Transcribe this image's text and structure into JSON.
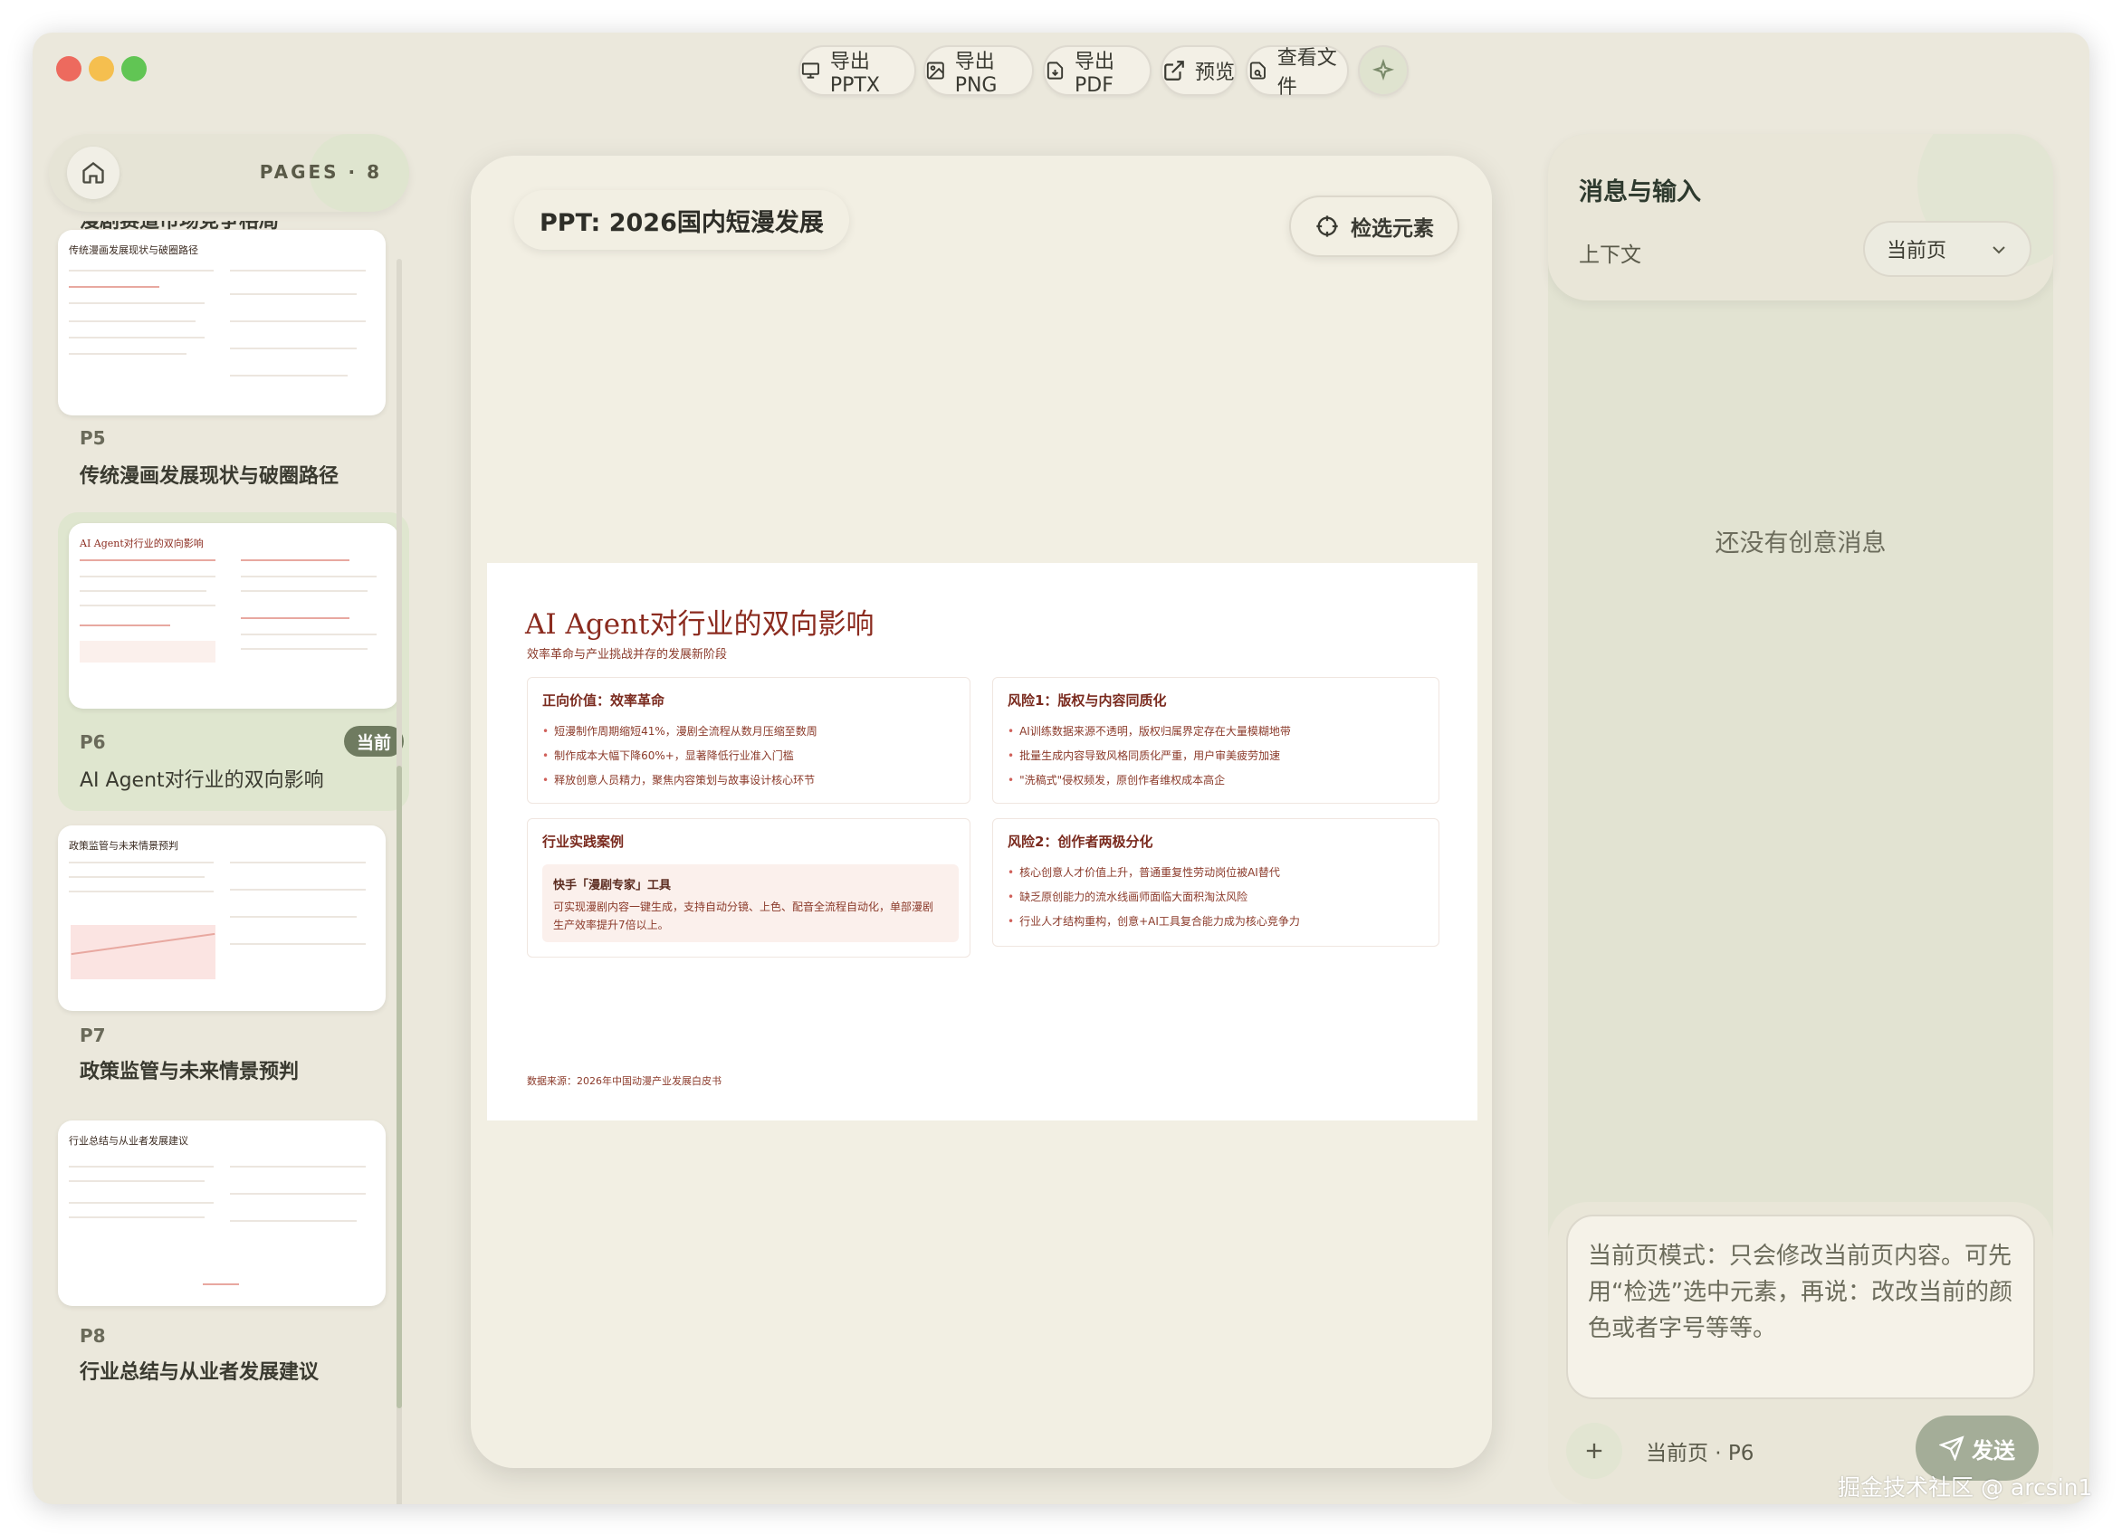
{
  "toolbar": {
    "export_pptx": "导出 PPTX",
    "export_png": "导出 PNG",
    "export_pdf": "导出 PDF",
    "preview": "预览",
    "view_files": "查看文件"
  },
  "sidebar": {
    "pages_label": "PAGES · 8",
    "partial_title": "漫剧赛道市场竞争格局",
    "slides": [
      {
        "num": "P5",
        "title": "传统漫画发展现状与破圈路径",
        "thumb_title": "传统漫画发展现状与破圈路径"
      },
      {
        "num": "P6",
        "title": "AI Agent对行业的双向影响",
        "thumb_title": "AI Agent对行业的双向影响",
        "badge": "当前"
      },
      {
        "num": "P7",
        "title": "政策监管与未来情景预判",
        "thumb_title": "政策监管与未来情景预判"
      },
      {
        "num": "P8",
        "title": "行业总结与从业者发展建议",
        "thumb_title": "行业总结与从业者发展建议"
      }
    ]
  },
  "center": {
    "ppt_title": "PPT: 2026国内短漫发展",
    "select_button": "检选元素"
  },
  "slide": {
    "title": "AI Agent对行业的双向影响",
    "subtitle": "效率革命与产业挑战并存的发展新阶段",
    "cards": [
      {
        "title": "正向价值：效率革命",
        "bullets": [
          "短漫制作周期缩短41%，漫剧全流程从数月压缩至数周",
          "制作成本大幅下降60%+，显著降低行业准入门槛",
          "释放创意人员精力，聚焦内容策划与故事设计核心环节"
        ]
      },
      {
        "title": "风险1：版权与内容同质化",
        "bullets": [
          "AI训练数据来源不透明，版权归属界定存在大量模糊地带",
          "批量生成内容导致风格同质化严重，用户审美疲劳加速",
          "\"洗稿式\"侵权频发，原创作者维权成本高企"
        ]
      },
      {
        "title": "行业实践案例",
        "case_title": "快手「漫剧专家」工具",
        "case_text_1": "可实现漫剧内容一键生成，支持自动分镜、上色、配音全流程自动化，单部漫剧",
        "case_text_2": "生产效率提升7倍以上。"
      },
      {
        "title": "风险2：创作者两极分化",
        "bullets": [
          "核心创意人才价值上升，普通重复性劳动岗位被AI替代",
          "缺乏原创能力的流水线画师面临大面积淘汰风险",
          "行业人才结构重构，创意+AI工具复合能力成为核心竞争力"
        ]
      }
    ],
    "source": "数据来源：2026年中国动漫产业发展白皮书"
  },
  "right": {
    "title": "消息与输入",
    "context_label": "上下文",
    "context_value": "当前页",
    "empty": "还没有创意消息",
    "input_placeholder": "当前页模式：只会修改当前页内容。可先用“检选”选中元素，再说：改改当前的颜色或者字号等等。",
    "page_mode": "当前页 · P6",
    "send": "发送"
  },
  "watermark": "掘金技术社区 @ arcsin1",
  "colors": {
    "accent": "#6f7b60",
    "slide_red": "#8b2b1f",
    "background": "#ebe8dc"
  }
}
